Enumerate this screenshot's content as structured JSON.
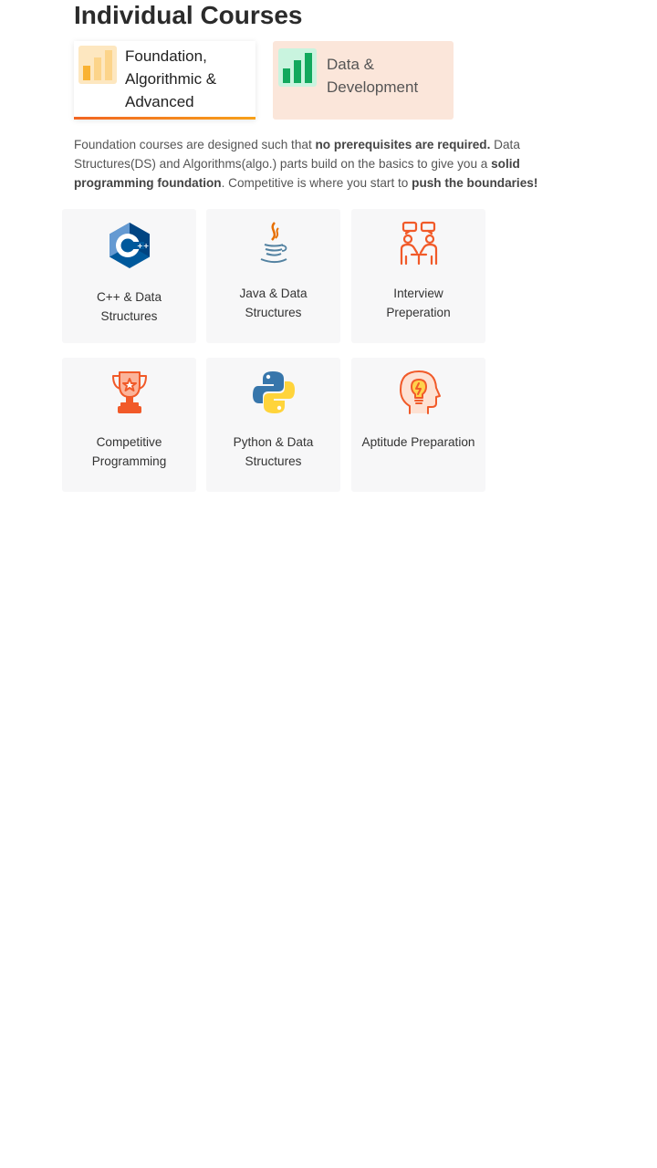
{
  "page": {
    "title": "Individual Courses"
  },
  "tabs": [
    {
      "label": "Foundation, Algorithmic & Advanced",
      "active": true,
      "icon": "bar-chart-icon",
      "icon_color": "#f9b233"
    },
    {
      "label": "Data & Development",
      "active": false,
      "icon": "bar-chart-icon",
      "icon_color": "#12a85d"
    }
  ],
  "description": {
    "part1": "Foundation courses are designed such that ",
    "bold1": "no prerequisites are required.",
    "part2": " Data Structures(DS) and Algorithms(algo.) parts build on the basics to give you a ",
    "bold2": "solid programming foundation",
    "part3": ". Competitive is where you start to ",
    "bold3": "push the boundaries!"
  },
  "courses": [
    {
      "label": "C++ & Data Structures",
      "icon": "cpp-icon"
    },
    {
      "label": "Java & Data Structures",
      "icon": "java-icon"
    },
    {
      "label": "Interview Preperation",
      "icon": "interview-icon"
    },
    {
      "label": "Competitive Programming",
      "icon": "trophy-icon"
    },
    {
      "label": "Python & Data Structures",
      "icon": "python-icon"
    },
    {
      "label": "Aptitude Preparation",
      "icon": "head-bulb-icon"
    }
  ],
  "colors": {
    "accent_orange": "#f26522",
    "accent_yellow": "#f7a11a",
    "tab_inactive_bg": "#fbe6da",
    "card_bg": "#f7f7f8",
    "icon_orange": "#f15a29"
  }
}
